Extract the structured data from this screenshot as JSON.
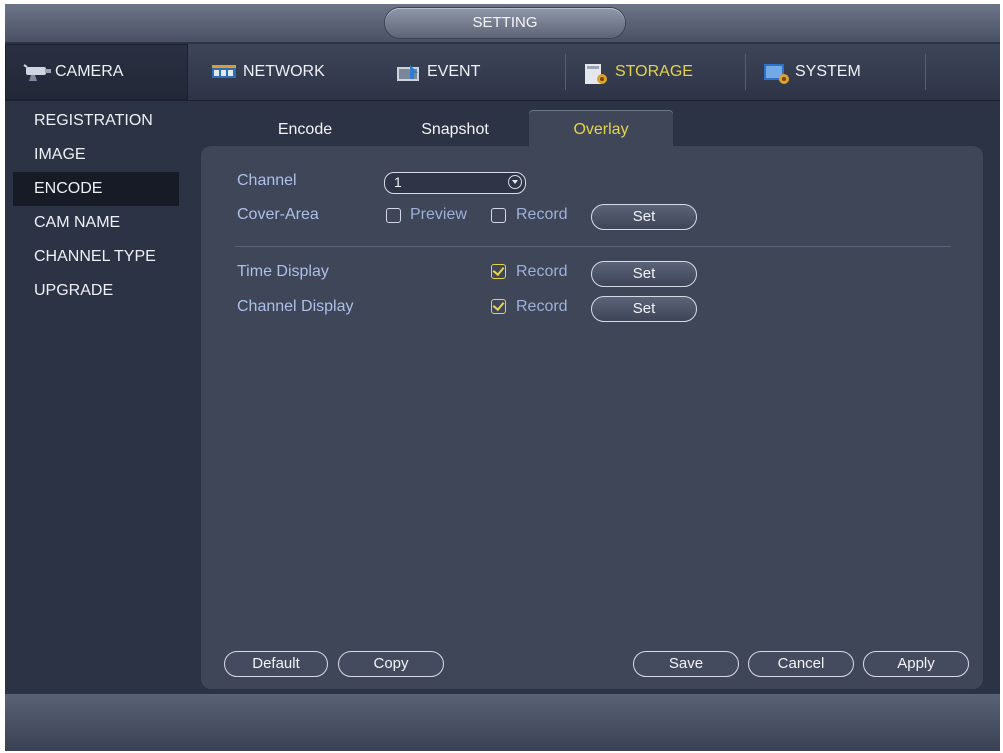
{
  "window": {
    "title": "SETTING"
  },
  "main_tabs": [
    {
      "label": "CAMERA",
      "icon": "camera-icon"
    },
    {
      "label": "NETWORK",
      "icon": "network-icon"
    },
    {
      "label": "EVENT",
      "icon": "event-icon"
    },
    {
      "label": "STORAGE",
      "icon": "storage-icon"
    },
    {
      "label": "SYSTEM",
      "icon": "system-icon"
    }
  ],
  "sidebar": {
    "items": [
      "REGISTRATION",
      "IMAGE",
      "ENCODE",
      "CAM NAME",
      "CHANNEL TYPE",
      "UPGRADE"
    ],
    "active": "ENCODE"
  },
  "sub_tabs": [
    "Encode",
    "Snapshot",
    "Overlay"
  ],
  "form": {
    "channel_label": "Channel",
    "channel_value": "1",
    "cover_area_label": "Cover-Area",
    "preview_label": "Preview",
    "record_label": "Record",
    "set_label": "Set",
    "time_display_label": "Time Display",
    "channel_display_label": "Channel Display",
    "cover_preview_checked": false,
    "cover_record_checked": false,
    "time_display_record_checked": true,
    "channel_display_record_checked": true
  },
  "buttons": {
    "default": "Default",
    "copy": "Copy",
    "save": "Save",
    "cancel": "Cancel",
    "apply": "Apply"
  },
  "colors": {
    "accent_yellow": "#e5d34a",
    "label_blue": "#aebfe8",
    "panel_bg": "#3f4658"
  }
}
